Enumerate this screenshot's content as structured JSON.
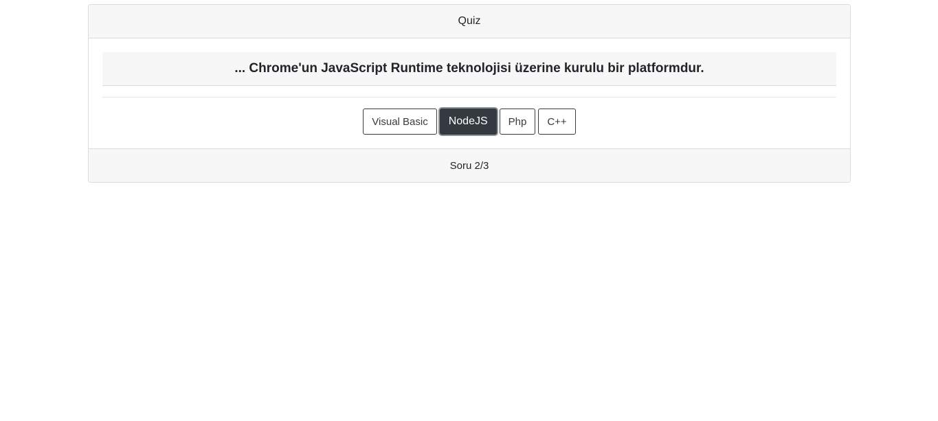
{
  "quiz": {
    "header_title": "Quiz",
    "question": "... Chrome'un JavaScript Runtime teknolojisi üzerine kurulu bir platformdur.",
    "answers": [
      {
        "label": "Visual Basic",
        "selected": false
      },
      {
        "label": "NodeJS",
        "selected": true
      },
      {
        "label": "Php",
        "selected": false
      },
      {
        "label": "C++",
        "selected": false
      }
    ],
    "footer_text": "Soru 2/3"
  },
  "colors": {
    "selected_button_bg": "#343a40",
    "card_header_bg": "#f7f7f7",
    "border": "#dcdcdc"
  }
}
